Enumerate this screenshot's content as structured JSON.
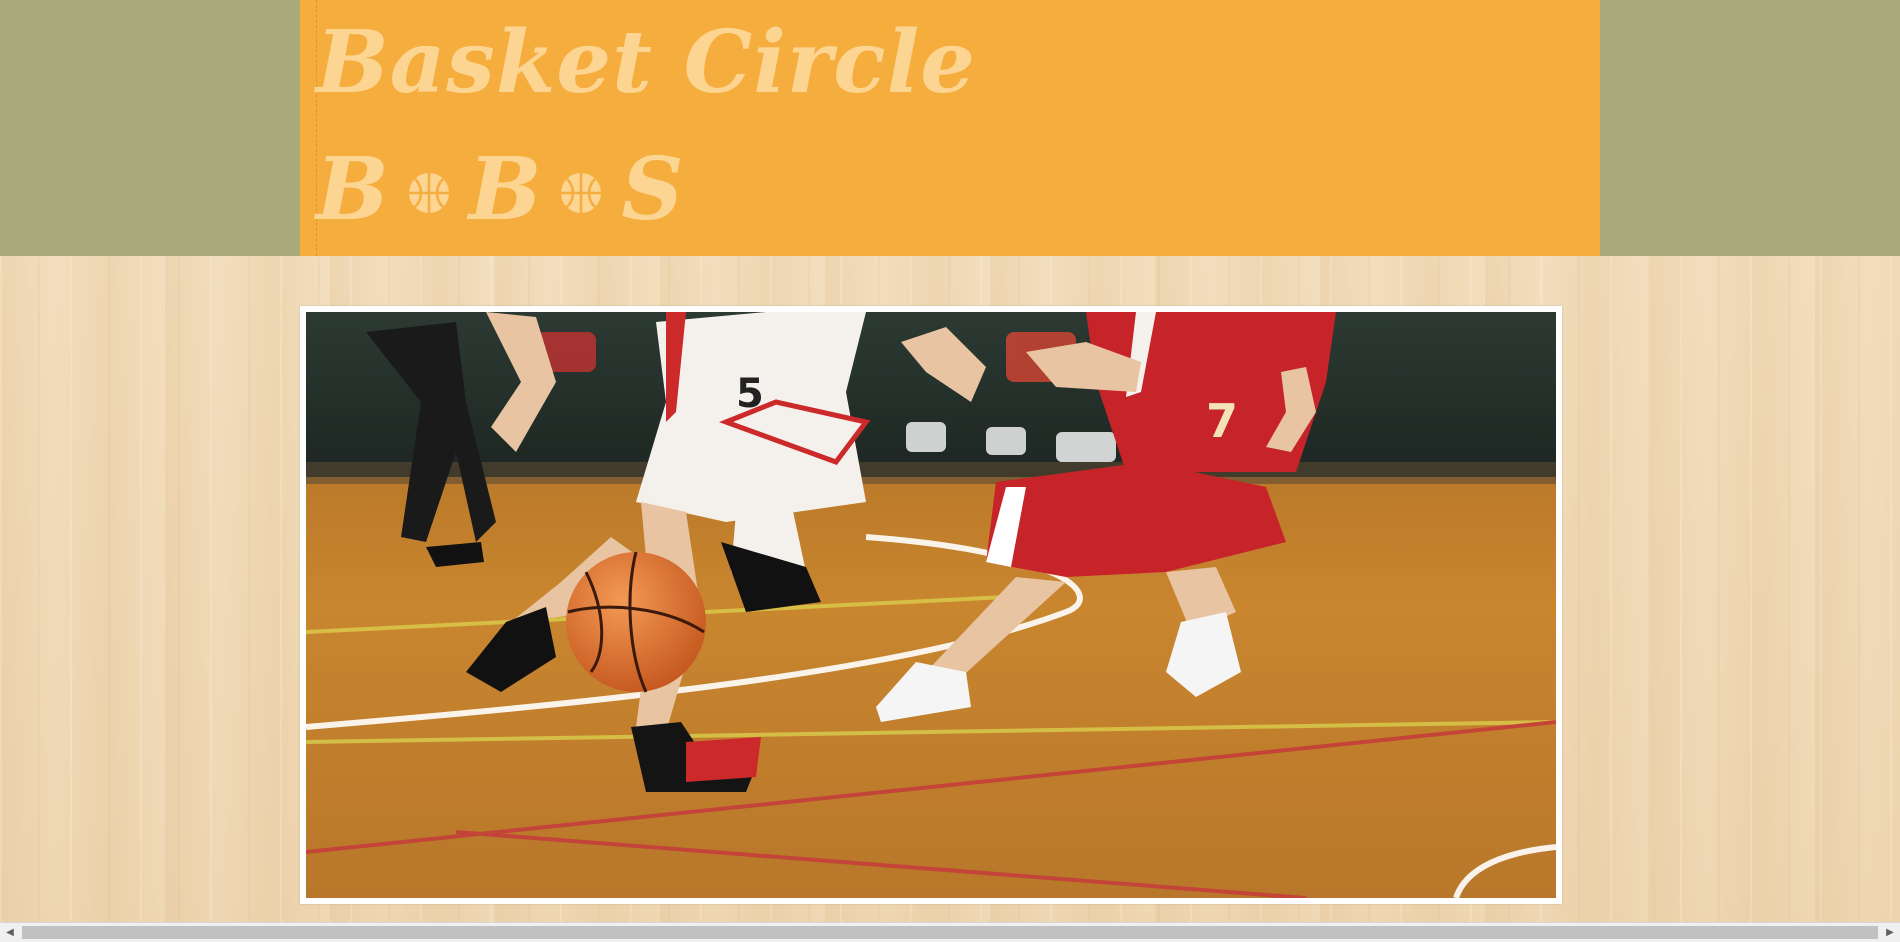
{
  "header": {
    "title": "Basket Circle",
    "logo": {
      "letters": [
        "B",
        "B",
        "S"
      ],
      "separator_icon": "basketball-icon"
    }
  },
  "colors": {
    "top_band": "#a8aa7c",
    "header_bg": "#f5ad3e",
    "header_text": "#fdd592",
    "page_bg": "#efd9b8"
  },
  "hero": {
    "icon": "basketball-game-photo"
  },
  "scrollbar": {
    "left_icon": "triangle-left-icon",
    "right_icon": "triangle-right-icon"
  }
}
